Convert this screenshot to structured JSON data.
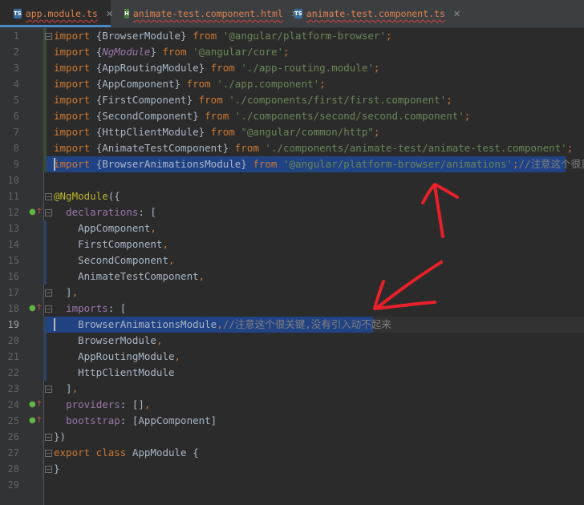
{
  "tabs": [
    {
      "label": "app.module.ts",
      "type": "TS",
      "color": "#3c6c9c",
      "active": true
    },
    {
      "label": "animate-test.component.html",
      "type": "H",
      "color": "#4a7d3f",
      "active": false
    },
    {
      "label": "animate-test.component.ts",
      "type": "TS",
      "color": "#3c6c9c",
      "active": false
    }
  ],
  "close_glyph": "✕",
  "gutter_marker": {
    "circle": "●",
    "arrow": "↑",
    "icon": "implementation-up-icon"
  },
  "code_lines": [
    {
      "number": "1",
      "tokens": [
        [
          "kw",
          "import "
        ],
        [
          "p",
          "{BrowserModule} "
        ],
        [
          "kw",
          "from "
        ],
        [
          "str",
          "'@angular/platform-browser'"
        ],
        [
          "kw",
          ";"
        ]
      ]
    },
    {
      "number": "2",
      "tokens": [
        [
          "kw",
          "import "
        ],
        [
          "p",
          "{"
        ],
        [
          "it",
          "NgModule"
        ],
        [
          "p",
          "} "
        ],
        [
          "kw",
          "from "
        ],
        [
          "str",
          "'@angular/core'"
        ],
        [
          "kw",
          ";"
        ]
      ]
    },
    {
      "number": "3",
      "tokens": [
        [
          "kw",
          "import "
        ],
        [
          "p",
          "{AppRoutingModule} "
        ],
        [
          "kw",
          "from "
        ],
        [
          "str",
          "'./app-routing.module'"
        ],
        [
          "kw",
          ";"
        ]
      ]
    },
    {
      "number": "4",
      "tokens": [
        [
          "kw",
          "import "
        ],
        [
          "p",
          "{AppComponent} "
        ],
        [
          "kw",
          "from "
        ],
        [
          "str",
          "'./app.component'"
        ],
        [
          "kw",
          ";"
        ]
      ]
    },
    {
      "number": "5",
      "tokens": [
        [
          "kw",
          "import "
        ],
        [
          "p",
          "{FirstComponent} "
        ],
        [
          "kw",
          "from "
        ],
        [
          "str",
          "'./components/first/first.component'"
        ],
        [
          "kw",
          ";"
        ]
      ]
    },
    {
      "number": "6",
      "tokens": [
        [
          "kw",
          "import "
        ],
        [
          "p",
          "{SecondComponent} "
        ],
        [
          "kw",
          "from "
        ],
        [
          "str",
          "'./components/second/second.component'"
        ],
        [
          "kw",
          ";"
        ]
      ]
    },
    {
      "number": "7",
      "tokens": [
        [
          "kw",
          "import "
        ],
        [
          "p",
          "{HttpClientModule} "
        ],
        [
          "kw",
          "from "
        ],
        [
          "str",
          "\"@angular/common/http\""
        ],
        [
          "kw",
          ";"
        ]
      ]
    },
    {
      "number": "8",
      "tokens": [
        [
          "kw",
          "import "
        ],
        [
          "p",
          "{AnimateTestComponent} "
        ],
        [
          "kw",
          "from "
        ],
        [
          "str",
          "'./components/animate-test/animate-test.component'"
        ],
        [
          "kw",
          ";"
        ]
      ]
    },
    {
      "number": "9",
      "tokens": [
        [
          "kw",
          "import "
        ],
        [
          "p",
          "{BrowserAnimationsModule} "
        ],
        [
          "kw",
          "from "
        ],
        [
          "str",
          "'@angular/platform-browser/animations'"
        ],
        [
          "kw",
          ";"
        ],
        [
          "cmt",
          "//注意这个很重要"
        ]
      ]
    },
    {
      "number": "10",
      "tokens": []
    },
    {
      "number": "11",
      "tokens": [
        [
          "dec",
          "@NgModule"
        ],
        [
          "p",
          "({"
        ]
      ]
    },
    {
      "number": "12",
      "tokens": [
        [
          "p",
          "  "
        ],
        [
          "prop",
          "declarations"
        ],
        [
          "p",
          ": ["
        ]
      ]
    },
    {
      "number": "13",
      "tokens": [
        [
          "p",
          "    AppComponent"
        ],
        [
          "kw",
          ","
        ]
      ]
    },
    {
      "number": "14",
      "tokens": [
        [
          "p",
          "    FirstComponent"
        ],
        [
          "kw",
          ","
        ]
      ]
    },
    {
      "number": "15",
      "tokens": [
        [
          "p",
          "    SecondComponent"
        ],
        [
          "kw",
          ","
        ]
      ]
    },
    {
      "number": "16",
      "tokens": [
        [
          "p",
          "    AnimateTestComponent"
        ],
        [
          "kw",
          ","
        ]
      ]
    },
    {
      "number": "17",
      "tokens": [
        [
          "p",
          "  ]"
        ],
        [
          "kw",
          ","
        ]
      ]
    },
    {
      "number": "18",
      "tokens": [
        [
          "p",
          "  "
        ],
        [
          "prop",
          "imports"
        ],
        [
          "p",
          ": ["
        ]
      ]
    },
    {
      "number": "19",
      "tokens": [
        [
          "p",
          "    BrowserAnimationsModule"
        ],
        [
          "kw",
          ","
        ],
        [
          "cmt",
          "//注意这个很关键,没有引入动不起来"
        ]
      ]
    },
    {
      "number": "20",
      "tokens": [
        [
          "p",
          "    BrowserModule"
        ],
        [
          "kw",
          ","
        ]
      ]
    },
    {
      "number": "21",
      "tokens": [
        [
          "p",
          "    AppRoutingModule"
        ],
        [
          "kw",
          ","
        ]
      ]
    },
    {
      "number": "22",
      "tokens": [
        [
          "p",
          "    HttpClientModule"
        ]
      ]
    },
    {
      "number": "23",
      "tokens": [
        [
          "p",
          "  ]"
        ],
        [
          "kw",
          ","
        ]
      ]
    },
    {
      "number": "24",
      "tokens": [
        [
          "p",
          "  "
        ],
        [
          "prop",
          "providers"
        ],
        [
          "p",
          ": []"
        ],
        [
          "kw",
          ","
        ]
      ]
    },
    {
      "number": "25",
      "tokens": [
        [
          "p",
          "  "
        ],
        [
          "prop",
          "bootstrap"
        ],
        [
          "p",
          ": [AppComponent]"
        ]
      ]
    },
    {
      "number": "26",
      "tokens": [
        [
          "p",
          "})"
        ]
      ]
    },
    {
      "number": "27",
      "tokens": [
        [
          "kw",
          "export class "
        ],
        [
          "p",
          "AppModule {"
        ]
      ]
    },
    {
      "number": "28",
      "tokens": [
        [
          "p",
          "}"
        ]
      ]
    },
    {
      "number": "29",
      "tokens": []
    }
  ]
}
